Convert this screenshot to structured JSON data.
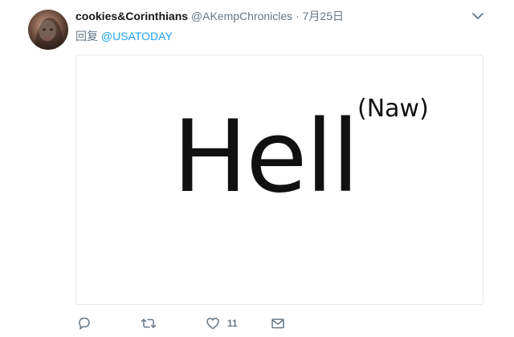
{
  "tweet": {
    "display_name": "cookies&Corinthians",
    "handle": "@AKempChronicles",
    "separator": "·",
    "date": "7月25日",
    "reply_prefix": "回复",
    "reply_mention": "@USATODAY",
    "media": {
      "main_text": "Hell",
      "superscript_text": "(Naw)"
    },
    "actions": {
      "reply_icon": "reply-icon",
      "retweet_icon": "retweet-icon",
      "like_icon": "heart-icon",
      "like_count": "11",
      "dm_icon": "envelope-icon"
    }
  },
  "colors": {
    "text_primary": "#14171a",
    "text_secondary": "#657786",
    "link": "#1da1f2",
    "border": "#e1e8ed"
  }
}
